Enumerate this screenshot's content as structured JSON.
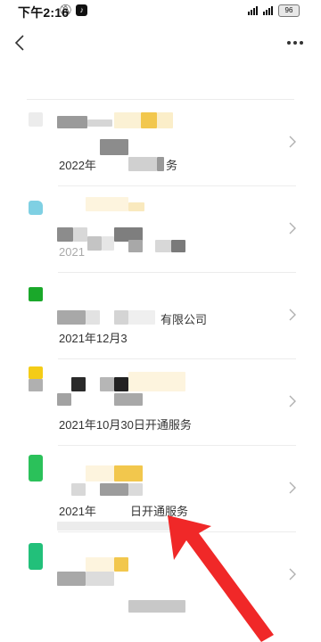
{
  "status_bar": {
    "time": "下午2:16",
    "battery": "96"
  },
  "nav": {
    "back_icon": "chevron-left-icon",
    "more_icon": "more-horizontal-icon"
  },
  "items": [
    {
      "icon_color": "#e8e8e8",
      "date": "2022年",
      "suffix": "务",
      "inline": ""
    },
    {
      "icon_color": "#7fd0e3",
      "date": "2021",
      "suffix": "",
      "inline": ""
    },
    {
      "icon_color": "#1aa82a",
      "date": "2021年12月3",
      "suffix": "",
      "inline": "有限公司"
    },
    {
      "icon_color": "#f4cc17",
      "date": "2021年10月30日开通服务",
      "suffix": "",
      "inline": ""
    },
    {
      "icon_color": "#2bc15a",
      "date": "2021年",
      "suffix": "日开通服务",
      "inline": ""
    },
    {
      "icon_color": "#22c07a",
      "date": "",
      "suffix": "",
      "inline": ""
    }
  ],
  "annotation": {
    "arrow_color": "#f02020"
  }
}
